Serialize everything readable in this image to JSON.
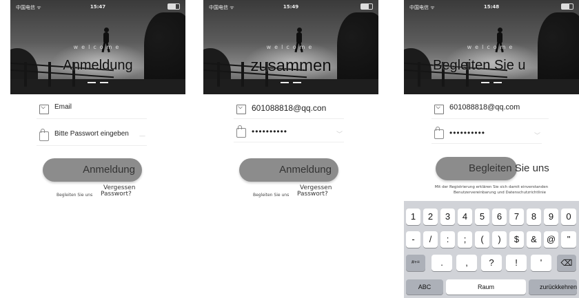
{
  "screens": [
    {
      "status": {
        "carrier": "中国电信 ᯤ",
        "time": "15:47"
      },
      "welcome": "welcome",
      "hero_title": "Anmeldung",
      "email": "Email",
      "password": "Bitte Passwort eingeben",
      "button": "Anmeldung",
      "signup_link": "Begleiten Sie uns",
      "forgot_line1": "Vergessen",
      "forgot_line2": "Passwort?"
    },
    {
      "status": {
        "carrier": "中国电信 ᯤ",
        "time": "15:49"
      },
      "welcome": "welcome",
      "hero_title": "zusammen",
      "email": "601088818@qq.con",
      "password": "••••••••••",
      "button": "Anmeldung",
      "signup_link": "Begleiten Sie uns",
      "forgot_line1": "Vergessen",
      "forgot_line2": "Passwort?"
    },
    {
      "status": {
        "carrier": "中国电信 ᯤ",
        "time": "15:48"
      },
      "welcome": "welcome",
      "hero_title": "Begleiten Sie u",
      "email": "601088818@qq.com",
      "password": "••••••••••",
      "button": "Begleiten Sie uns",
      "terms_line1": "Mit der Registrierung erklären Sie sich damit einverstanden",
      "terms_line2": "Benutzervereinbarung und Datenschutzrichtlinie",
      "keyboard": {
        "row1": [
          "1",
          "2",
          "3",
          "4",
          "5",
          "6",
          "7",
          "8",
          "9",
          "0"
        ],
        "row2": [
          "-",
          "/",
          ":",
          ";",
          "(",
          ")",
          "$",
          "&",
          "@",
          "\""
        ],
        "row3": [
          "#+=",
          ".",
          ",",
          "?",
          "!",
          "'",
          "⌫"
        ],
        "row4": [
          "ABC",
          "Raum",
          "zurückkehren"
        ]
      }
    }
  ]
}
